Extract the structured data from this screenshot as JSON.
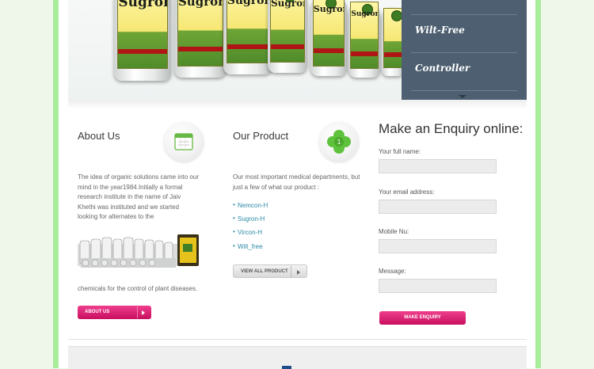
{
  "banner": {
    "bottle_label": "Sugron-H",
    "slider": {
      "items": [
        "Wilt-Free",
        "Controller"
      ]
    }
  },
  "about": {
    "title": "About Us",
    "body": "The idea of organic solutions came into our mind in the year1984.Initially a formal research institute in the name of Jaiv Khethi was instituted and we started looking for alternates to the",
    "body_end": "chemicals for the control of plant diseases.",
    "button_label": "About Us",
    "icon": "calendar-icon"
  },
  "product": {
    "title": "Our Product",
    "intro": "Our most important medical departments, but just a few of what our product :",
    "items": [
      "Nemcon-H",
      "Sugron-H",
      "Vircon-H",
      "Wilt_free"
    ],
    "button_label": "View All Product",
    "icon": "clover-icon"
  },
  "enquiry": {
    "title": "Make an Enquiry online:",
    "fields": {
      "name_label": "Your full name:",
      "email_label": "Your email address:",
      "mobile_label": "Mobile Nu:",
      "message_label": "Message:"
    },
    "submit_label": "Make Enquiry"
  },
  "colors": {
    "accent_pink": "#d4176d",
    "slider_bg": "#4d5f70",
    "side_green": "#a8ec9c",
    "link_blue": "#2d8aa7"
  }
}
